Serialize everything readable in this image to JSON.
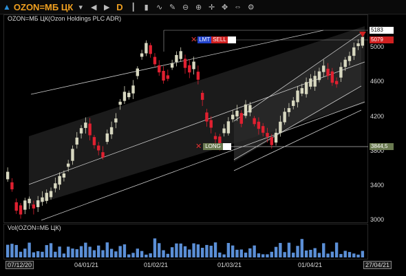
{
  "toolbar": {
    "symbol": "OZON=МБ ЦК",
    "period": "D",
    "icons": [
      "dropdown-icon",
      "back-icon",
      "forward-icon",
      "bar-chart-icon",
      "candle-chart-icon",
      "line-chart-icon",
      "draw-pen-icon",
      "zoom-out-icon",
      "zoom-in-icon",
      "crosshair-icon",
      "move-icon",
      "fit-icon",
      "settings-icon"
    ]
  },
  "chart": {
    "title": "OZON=МБ ЦК(Ozon Holdings PLC ADR)",
    "volume_title": "Vol(OZON=МБ ЦК)",
    "last_price_tag": "5183",
    "sell_price_tag": "5079",
    "long_price_tag": "3844,5",
    "lmt_label": "LMT",
    "sell_label": "SELL",
    "long_label": "LONG",
    "y_ticks": [
      "5000",
      "4600",
      "4200",
      "3800",
      "3400",
      "3000"
    ],
    "x_ticks": [
      "04/01/21",
      "01/02/21",
      "01/03/21",
      "01/04/21"
    ],
    "x_start": "07/12/20",
    "x_end": "27/04/21",
    "colors": {
      "up": "#d8d8c0",
      "down": "#e02030",
      "volume": "#5b8fd6",
      "sell": "#d02020",
      "lmt": "#2244cc",
      "long_tag": "#6a7a50",
      "accent": "#f0a020"
    }
  }
}
